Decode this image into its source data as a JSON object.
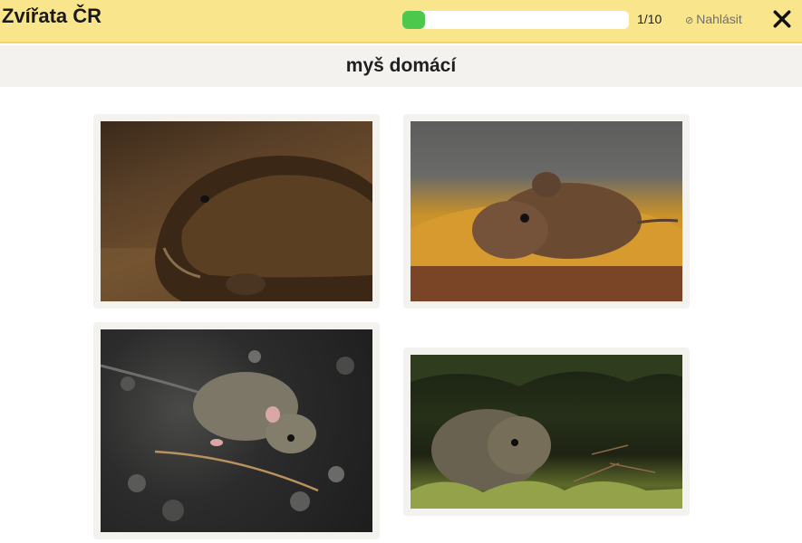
{
  "app": {
    "title": "Zvířata ČR"
  },
  "progress": {
    "current": 1,
    "total": 10,
    "label": "1/10",
    "fraction": 0.1
  },
  "report": {
    "icon": "flag-icon",
    "label": "Nahlásit"
  },
  "close": {
    "icon": "close-icon"
  },
  "question": {
    "word": "myš domácí"
  },
  "colors": {
    "topbar": "#f8e58c",
    "progress_fill": "#4cc94c",
    "question_bar": "#f3f2ef"
  },
  "answers": [
    {
      "subject": "beaver-photo"
    },
    {
      "subject": "vole-on-stump-photo"
    },
    {
      "subject": "mouse-on-gravel-photo"
    },
    {
      "subject": "vole-in-grass-photo"
    }
  ]
}
